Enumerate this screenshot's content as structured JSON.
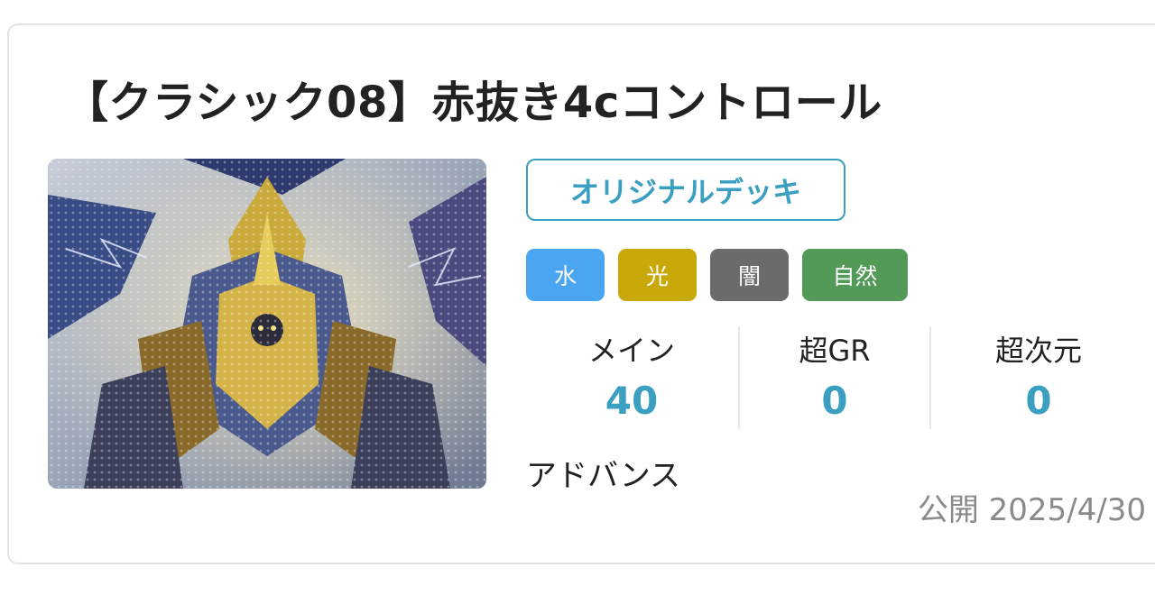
{
  "deck": {
    "title": "【クラシック08】赤抜き4cコントロール",
    "image_icon": "deck-art-image",
    "type_badge": "オリジナルデッキ",
    "civilizations": [
      {
        "label": "水",
        "color": "#4aa6f0"
      },
      {
        "label": "光",
        "color": "#c9a80a"
      },
      {
        "label": "闇",
        "color": "#6b6b6b"
      },
      {
        "label": "自然",
        "color": "#539a58"
      }
    ],
    "stats": [
      {
        "label": "メイン",
        "value": "40"
      },
      {
        "label": "超GR",
        "value": "0"
      },
      {
        "label": "超次元",
        "value": "0"
      }
    ],
    "format": "アドバンス",
    "published": "公開 2025/4/30",
    "accent_color": "#3a9fc0"
  }
}
